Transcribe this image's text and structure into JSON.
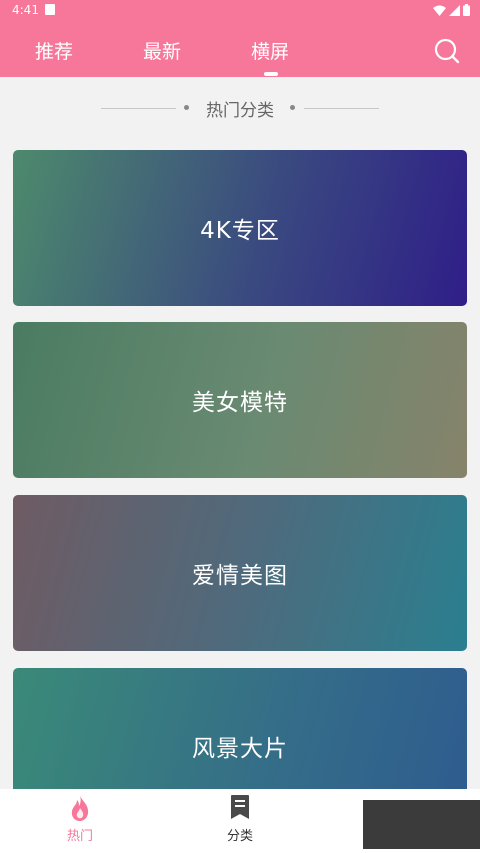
{
  "status_bar": {
    "time": "4:41"
  },
  "header": {
    "tabs": [
      {
        "label": "推荐"
      },
      {
        "label": "最新"
      },
      {
        "label": "横屏",
        "active": true
      }
    ],
    "search_icon": "search-icon"
  },
  "section": {
    "title": "热门分类"
  },
  "categories": [
    {
      "label": "4K专区"
    },
    {
      "label": "美女模特"
    },
    {
      "label": "爱情美图"
    },
    {
      "label": "风景大片"
    }
  ],
  "bottom_nav": [
    {
      "label": "热门",
      "icon": "flame-icon",
      "active": true
    },
    {
      "label": "分类",
      "icon": "bookmark-list-icon"
    }
  ],
  "colors": {
    "accent": "#f7779a",
    "background": "#f2f2f2"
  }
}
